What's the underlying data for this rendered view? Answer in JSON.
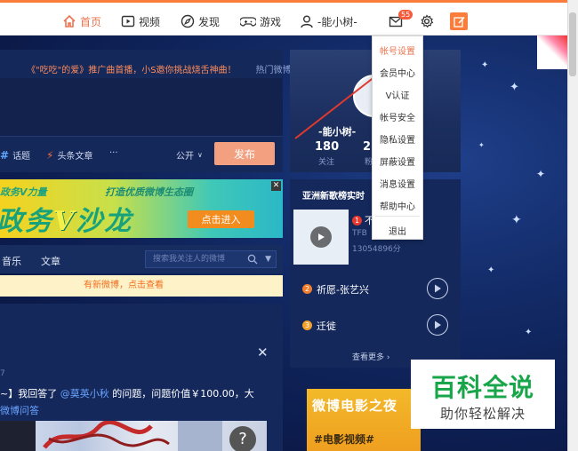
{
  "nav": {
    "home": "首页",
    "video": "视频",
    "discover": "发现",
    "games": "游戏",
    "username": "-能小树-",
    "message_count": "55"
  },
  "dropdown": {
    "items": [
      "帐号设置",
      "会员中心",
      "V认证",
      "帐号安全",
      "隐私设置",
      "屏蔽设置",
      "消息设置",
      "帮助中心"
    ],
    "logout": "退出"
  },
  "publish": {
    "promo": "《\"吃吃\"的爱》推广曲首播，小S邀你挑战烧舌神曲！",
    "hot": "热门微博",
    "topic": "话题",
    "article": "头条文章",
    "more": "···",
    "visibility": "公开",
    "publish_button": "发布"
  },
  "banner": {
    "small_left": "政务V力量",
    "small_right": "打造优质微博生态圈",
    "big_before": "政务",
    "big_v": "V",
    "big_after": "沙龙",
    "enter": "点击进入"
  },
  "tabs": {
    "music": "音乐",
    "article": "文章",
    "search_placeholder": "搜索我关注人的微博"
  },
  "feed": {
    "new_notice": "有新微博，点击查看",
    "num": "7",
    "text_a": "~】我回答了 ",
    "mention": "@莫英小秋",
    "text_b": " 的问题，问题价值￥100.00，大",
    "source": "微博问答"
  },
  "profile": {
    "name": "-能小树-",
    "following": "180",
    "following_label": "关注",
    "followers": "2",
    "followers_label": "粉"
  },
  "chart": {
    "title": "亚洲新歌榜实时",
    "song1_name": "不",
    "song1_sub": "TFB",
    "song1_score": "13054896分",
    "song2": "祈愿-张艺兴",
    "song3": "迁徙",
    "more": "查看更多 ›"
  },
  "movie_ad": {
    "line1": "微博电影之夜",
    "line2": "#电影视频#"
  },
  "watermark": {
    "title": "百科全说",
    "subtitle": "助你轻松解决"
  },
  "colors": {
    "accent": "#fa7d3c",
    "rank1": "#e7382d",
    "rank2": "#f07d2b",
    "rank3": "#f4a12b",
    "arrow": "#e0392d"
  }
}
